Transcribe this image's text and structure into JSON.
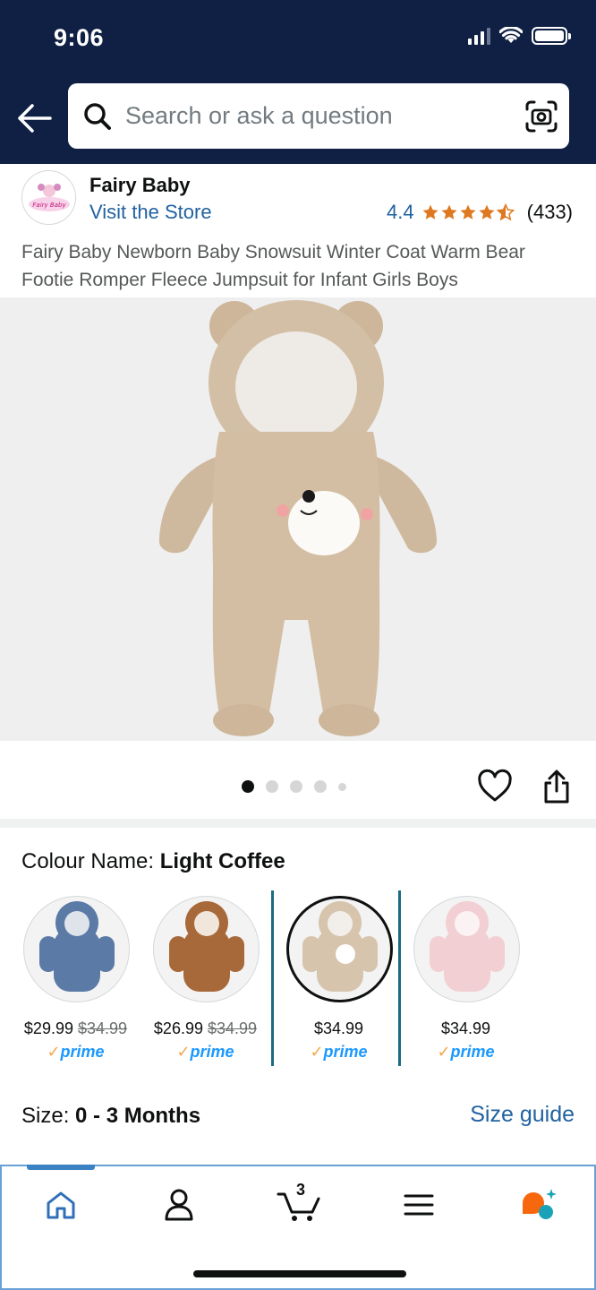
{
  "status_bar": {
    "time": "9:06"
  },
  "search": {
    "placeholder": "Search or ask a question"
  },
  "brand": {
    "name": "Fairy Baby",
    "logo_text": "Fairy Baby",
    "visit_store": "Visit the Store",
    "rating": "4.4",
    "rating_count": "(433)"
  },
  "product": {
    "title": "Fairy Baby Newborn Baby Snowsuit Winter Coat Warm Bear Footie Romper Fleece Jumpsuit for Infant Girls Boys",
    "image_count": 5,
    "active_image": 1
  },
  "colour": {
    "label": "Colour Name: ",
    "selected": "Light Coffee",
    "swatches": [
      {
        "color": "#5b7aa6",
        "price": "$29.99",
        "list_price": "$34.99",
        "prime": "prime"
      },
      {
        "color": "#a8693a",
        "price": "$26.99",
        "list_price": "$34.99",
        "prime": "prime"
      },
      {
        "color": "#d6c4ad",
        "price": "$34.99",
        "list_price": "",
        "prime": "prime"
      },
      {
        "color": "#f2cfd2",
        "price": "$34.99",
        "list_price": "",
        "prime": "prime"
      }
    ]
  },
  "size": {
    "label": "Size: ",
    "selected": "0 - 3 Months",
    "guide": "Size guide"
  },
  "nav": {
    "cart_count": "3"
  },
  "colors": {
    "header": "#0f2044",
    "link": "#2162a1",
    "star": "#de7921",
    "prime": "#1a98ff"
  }
}
